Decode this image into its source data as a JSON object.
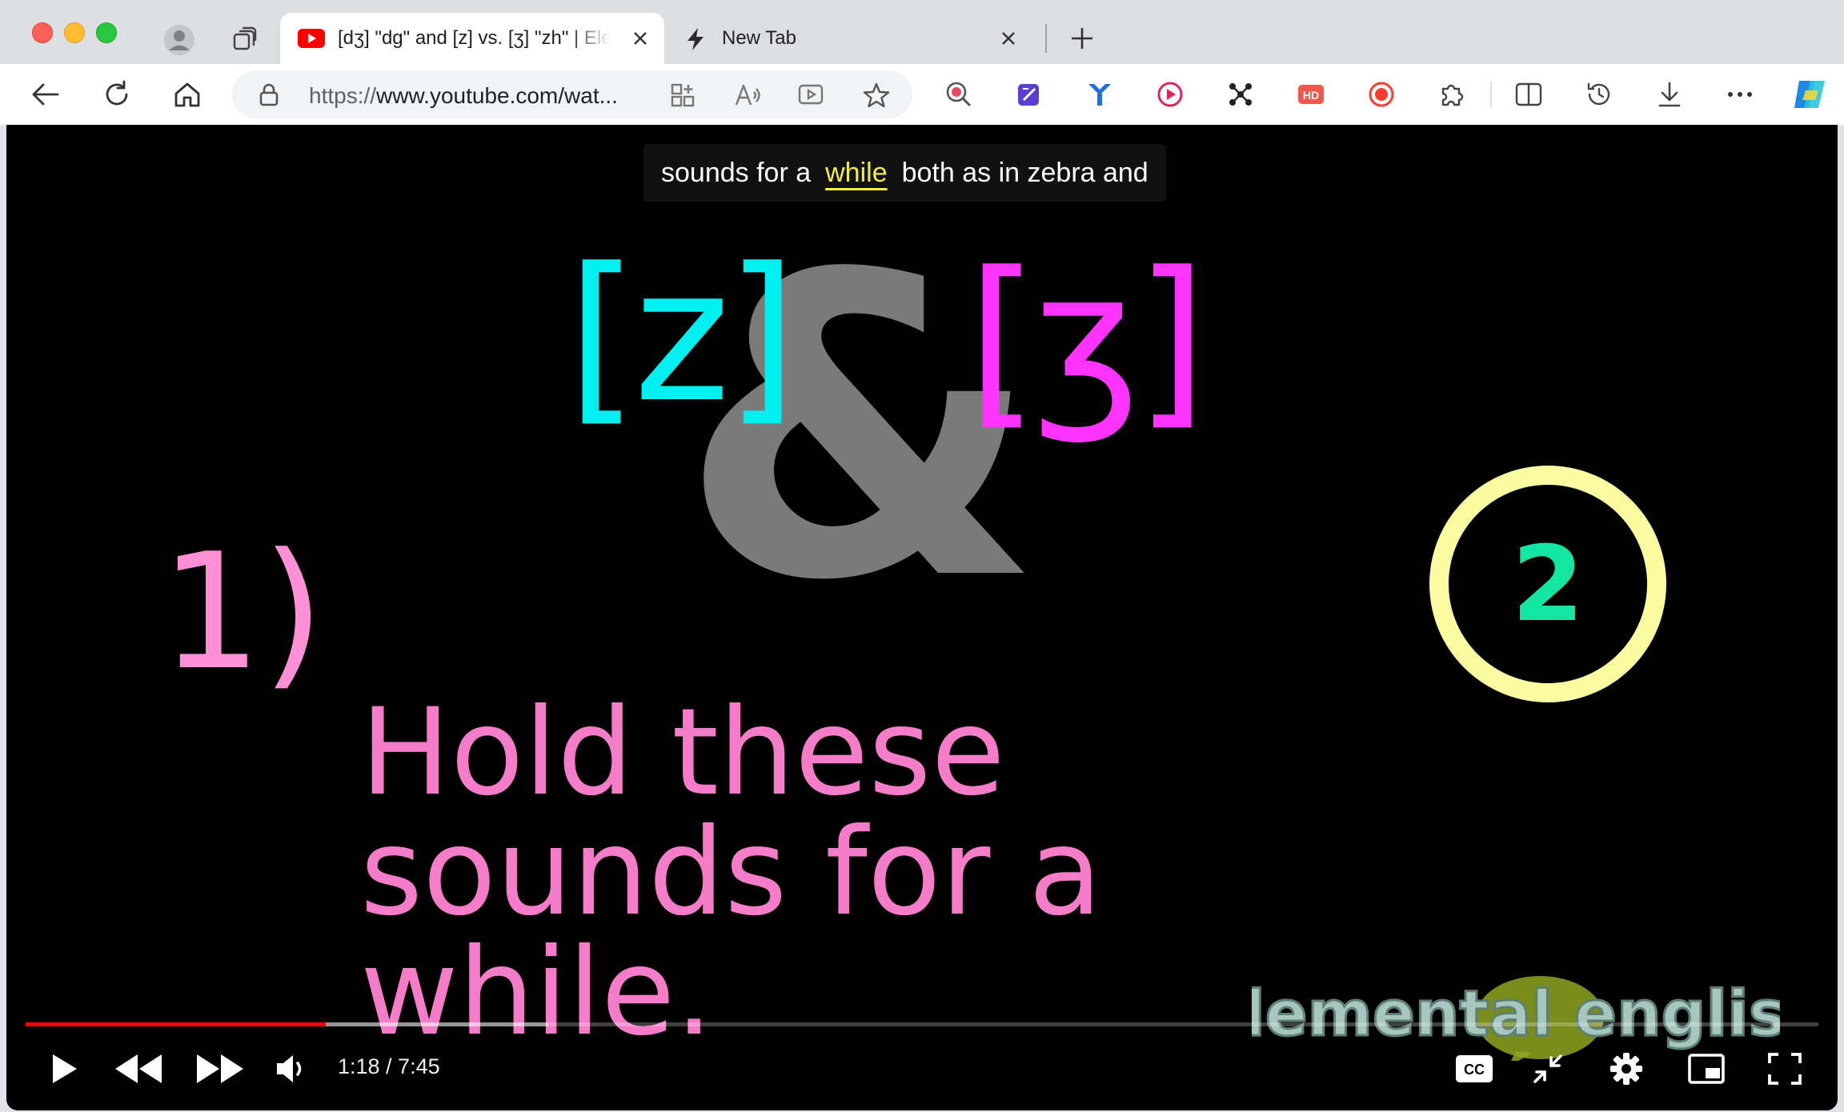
{
  "colors": {
    "progress_played": "#ff0000",
    "subtitle_highlight": "#f2ee3b",
    "z_symbol": "#00f0f0",
    "zh_symbol": "#ff33ff",
    "lesson_text": "#f47cc8",
    "badge_ring": "#fbfba0",
    "badge_number": "#12e6a0"
  },
  "tabs": [
    {
      "title": "[dʒ] \"dg\" and [z] vs. [ʒ] \"zh\" | Elemental English",
      "favicon": "youtube-icon",
      "active": true
    },
    {
      "title": "New Tab",
      "favicon": "lightning-icon",
      "active": false
    }
  ],
  "address_bar": {
    "url_prefix": "https://",
    "url_rest": "www.youtube.com/wat..."
  },
  "video": {
    "subtitle": {
      "before": "sounds for a",
      "highlight": "while",
      "after": "both as in zebra and"
    },
    "slide": {
      "symbol_z": "[z]",
      "ampersand": "&",
      "symbol_zh": "[ʒ]",
      "step_number": "1)",
      "text": "Hold these sounds for a while.",
      "badge": "2"
    },
    "logo_text": "elemental english",
    "time_display": "1:18 / 7:45",
    "played_fraction": 0.1674,
    "buffered_fraction": 0.2917
  }
}
